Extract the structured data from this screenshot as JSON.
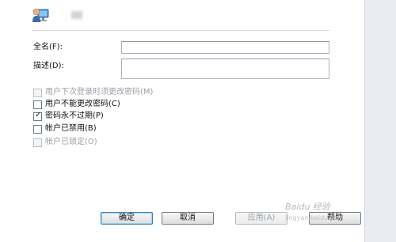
{
  "header": {
    "icon": "user-icon"
  },
  "form": {
    "fullname_label": "全名(F):",
    "fullname_value": "",
    "description_label": "描述(D):",
    "description_value": ""
  },
  "options": [
    {
      "label": "用户下次登录时须更改密码(M)",
      "checked": false,
      "disabled": true
    },
    {
      "label": "用户不能更改密码(C)",
      "checked": false,
      "disabled": false
    },
    {
      "label": "密码永不过期(P)",
      "checked": true,
      "disabled": false
    },
    {
      "label": "帐户已禁用(B)",
      "checked": false,
      "disabled": false
    },
    {
      "label": "帐户已锁定(O)",
      "checked": false,
      "disabled": true
    }
  ],
  "buttons": {
    "ok": "确定",
    "cancel": "取消",
    "apply": "应用(A)",
    "help": "帮助"
  },
  "watermark": {
    "text": "Baidu 经验",
    "sub": "jingyan.baidu.com"
  },
  "colors": {
    "panel_bg": "#ffffff",
    "window_bg": "#e9edf2",
    "default_button_border": "#3c7fb1"
  }
}
